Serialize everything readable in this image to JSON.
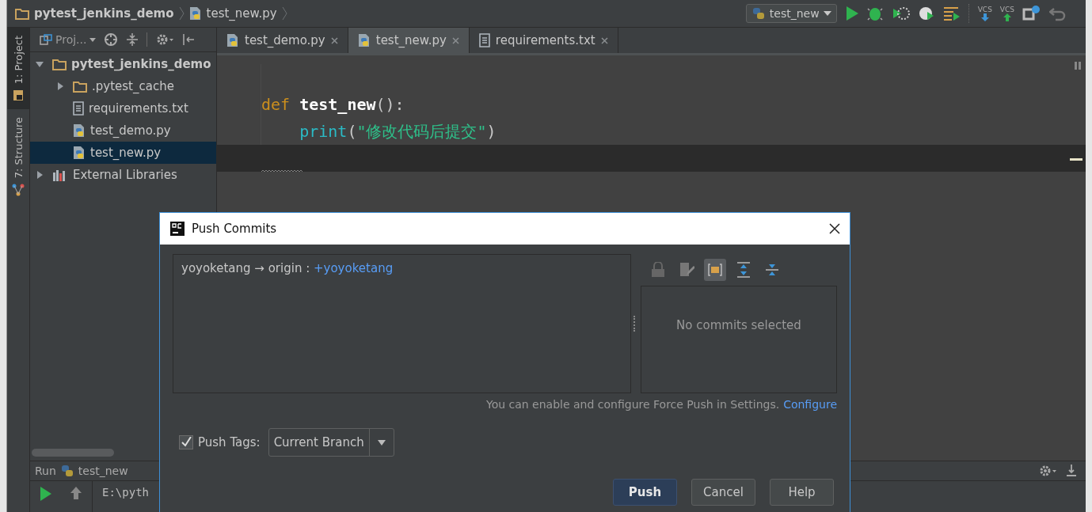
{
  "breadcrumb": [
    {
      "label": "pytest_jenkins_demo",
      "kind": "folder"
    },
    {
      "label": "test_new.py",
      "kind": "python"
    }
  ],
  "toolbar": {
    "run_config": "test_new",
    "vcs_update": "VCS",
    "vcs_commit": "VCS"
  },
  "tool_strip": [
    {
      "label": "1: Project",
      "selected": true,
      "kind": "project"
    },
    {
      "label": "7: Structure",
      "selected": false,
      "kind": "structure"
    }
  ],
  "project_panel": {
    "title": "Proj...",
    "tree": [
      {
        "label": "pytest_jenkins_demo",
        "kind": "folder",
        "expanded": true,
        "selected": false,
        "children": [
          {
            "label": ".pytest_cache",
            "kind": "folder",
            "expanded": false,
            "selected": false
          },
          {
            "label": "requirements.txt",
            "kind": "text",
            "selected": false
          },
          {
            "label": "test_demo.py",
            "kind": "python",
            "selected": false
          },
          {
            "label": "test_new.py",
            "kind": "python",
            "selected": true
          }
        ]
      },
      {
        "label": "External Libraries",
        "kind": "library",
        "expanded": false,
        "selected": false
      }
    ]
  },
  "tabs": [
    {
      "label": "test_demo.py",
      "kind": "python",
      "selected": false
    },
    {
      "label": "test_new.py",
      "kind": "python",
      "selected": true
    },
    {
      "label": "requirements.txt",
      "kind": "text",
      "selected": false
    }
  ],
  "code_lines": [
    {
      "tokens": [
        {
          "text": "def ",
          "kind": "keyword"
        },
        {
          "text": "test_new",
          "kind": "name"
        },
        {
          "text": "():",
          "kind": "plain"
        }
      ]
    },
    {
      "tokens": [
        {
          "text": "    print",
          "kind": "builtin"
        },
        {
          "text": "(",
          "kind": "plain"
        },
        {
          "text": "\"修改代码后提交\"",
          "kind": "string"
        },
        {
          "text": ")",
          "kind": "plain"
        }
      ]
    }
  ],
  "run_panel": {
    "label": "Run",
    "config": "test_new",
    "console": "E:\\pyth"
  },
  "dialog": {
    "title": "Push Commits",
    "push_line": {
      "source": "yoyoketang → origin : ",
      "target": "+yoyoketang"
    },
    "detail_toolbar": [
      {
        "kind": "lock",
        "selected": false
      },
      {
        "kind": "edit",
        "selected": false
      },
      {
        "kind": "details",
        "selected": true
      },
      {
        "kind": "expand",
        "selected": false
      },
      {
        "kind": "collapse",
        "selected": false
      }
    ],
    "detail_empty": "No commits selected",
    "hint": "You can enable and configure Force Push in Settings.",
    "hint_link": "Configure",
    "push_tags": {
      "label": "Push Tags:",
      "checked": true,
      "value": "Current Branch"
    },
    "buttons": [
      {
        "label": "Push",
        "default": true
      },
      {
        "label": "Cancel",
        "default": false
      },
      {
        "label": "Help",
        "default": false
      }
    ]
  }
}
